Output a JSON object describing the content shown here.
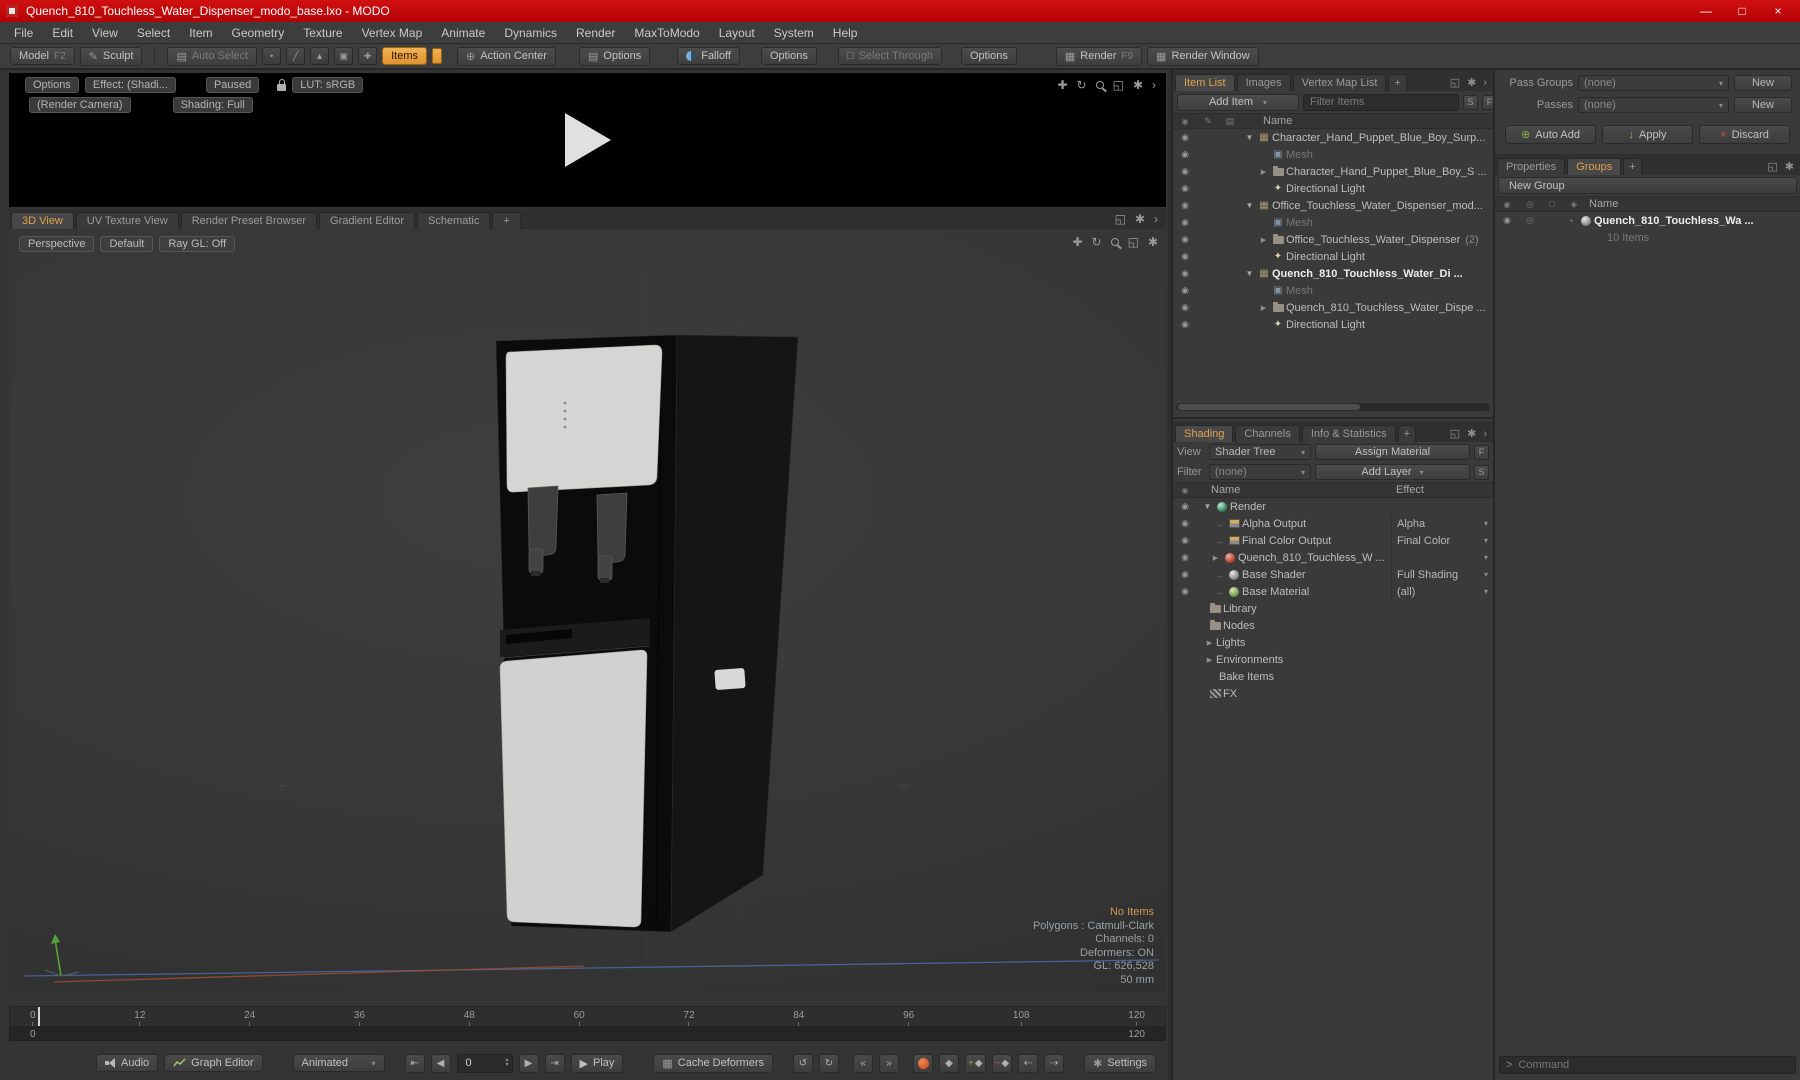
{
  "window": {
    "title": "Quench_810_Touchless_Water_Dispenser_modo_base.lxo - MODO"
  },
  "colors": {
    "titlebar_red": "#c00808",
    "accent_orange": "#e9a23f",
    "record_red": "#cc4a22",
    "no_items_orange": "#d09a50"
  },
  "icons": {
    "gear": "✱",
    "move": "✚",
    "rotate_cw": "↻",
    "rotate_ccw": "↺",
    "corner": "◱",
    "chevron": "›",
    "dropdown": "▾",
    "tri_down": "▼",
    "tri_right": "▶",
    "branch": "→",
    "spin_up": "▴",
    "spin_down": "▾",
    "play": "▶",
    "r_play": "▶",
    "rev": "◀",
    "to_start": "⇤",
    "to_end": "⇥",
    "step_back": "«",
    "step_fwd": "»",
    "key": "◆",
    "key_add": "+",
    "key_del": "−",
    "key_prev": "⇠",
    "key_next": "⇢",
    "check": "✓",
    "cross": "×",
    "down_arrow": "↓",
    "plus": "+",
    "eye": "◉",
    "min": "—",
    "max": "□",
    "close": "×",
    "pencil": "✎",
    "grid": "▤",
    "cube": "▦",
    "mesh": "▣",
    "light": "✦",
    "action": "⊕",
    "dot": "•",
    "slash": "╱",
    "tri": "▲",
    "circle": "◎",
    "diamond": "◈",
    "box": "□"
  },
  "menu": [
    "File",
    "Edit",
    "View",
    "Select",
    "Item",
    "Geometry",
    "Texture",
    "Vertex Map",
    "Animate",
    "Dynamics",
    "Render",
    "MaxToModo",
    "Layout",
    "System",
    "Help"
  ],
  "toolbar": {
    "model": "Model",
    "model_key": "F2",
    "sculpt": "Sculpt",
    "auto_select": "Auto Select",
    "items": "Items",
    "action_center": "Action Center",
    "options_a": "Options",
    "falloff": "Falloff",
    "options_b": "Options",
    "select_through": "Select Through",
    "options_c": "Options",
    "render": "Render",
    "render_key": "F9",
    "render_window": "Render Window"
  },
  "preview": {
    "options": "Options",
    "effect": "Effect: (Shadi...",
    "paused": "Paused",
    "lut": "LUT: sRGB",
    "render_camera": "(Render Camera)",
    "shading": "Shading: Full"
  },
  "viewport": {
    "tabs": [
      "3D View",
      "UV Texture View",
      "Render Preset Browser",
      "Gradient Editor",
      "Schematic"
    ],
    "add_tab": "+",
    "perspective": "Perspective",
    "default": "Default",
    "raygl": "Ray GL: Off",
    "no_items": "No Items",
    "stats": [
      "Polygons : Catmull-Clark",
      "Channels: 0",
      "Deformers: ON",
      "GL: 626,528",
      "50 mm"
    ]
  },
  "timeline": {
    "ticks": [
      "0",
      "12",
      "24",
      "36",
      "48",
      "60",
      "72",
      "84",
      "96",
      "108",
      "120"
    ],
    "range_start": "0",
    "range_end": "120"
  },
  "transport": {
    "audio": "Audio",
    "graph_editor": "Graph Editor",
    "mode": "Animated",
    "frame": "0",
    "play": "Play",
    "cache_deformers": "Cache Deformers",
    "settings": "Settings"
  },
  "item_list": {
    "tabs": [
      "Item List",
      "Images",
      "Vertex Map List"
    ],
    "add_tab": "+",
    "add_item": "Add Item",
    "filter_placeholder": "Filter Items",
    "btn_s": "S",
    "btn_f": "F",
    "name_header": "Name",
    "rows": [
      {
        "label": "Character_Hand_Puppet_Blue_Boy_Surp..."
      },
      {
        "label": "Mesh"
      },
      {
        "label": "Character_Hand_Puppet_Blue_Boy_S ..."
      },
      {
        "label": "Directional Light"
      },
      {
        "label": "Office_Touchless_Water_Dispenser_mod..."
      },
      {
        "label": "Mesh"
      },
      {
        "label": "Office_Touchless_Water_Dispenser",
        "suffix": "(2)"
      },
      {
        "label": "Directional Light"
      },
      {
        "label": "Quench_810_Touchless_Water_Di ..."
      },
      {
        "label": "Mesh"
      },
      {
        "label": "Quench_810_Touchless_Water_Dispe ..."
      },
      {
        "label": "Directional Light"
      }
    ]
  },
  "shading": {
    "tabs": [
      "Shading",
      "Channels",
      "Info & Statistics"
    ],
    "add_tab": "+",
    "view_label": "View",
    "view_value": "Shader Tree",
    "assign_material": "Assign Material",
    "btn_f": "F",
    "filter_label": "Filter",
    "filter_value": "(none)",
    "add_layer": "Add Layer",
    "btn_s": "S",
    "name_header": "Name",
    "effect_header": "Effect",
    "rows": [
      {
        "label": "Render",
        "effect": ""
      },
      {
        "label": "Alpha Output",
        "effect": "Alpha"
      },
      {
        "label": "Final Color Output",
        "effect": "Final Color"
      },
      {
        "label": "Quench_810_Touchless_W ...",
        "effect": ""
      },
      {
        "label": "Base Shader",
        "effect": "Full Shading"
      },
      {
        "label": "Base Material",
        "effect": "(all)"
      },
      {
        "label": "Library"
      },
      {
        "label": "Nodes"
      },
      {
        "label": "Lights"
      },
      {
        "label": "Environments"
      },
      {
        "label": "Bake Items"
      },
      {
        "label": "FX"
      }
    ]
  },
  "passes": {
    "pass_groups_label": "Pass Groups",
    "pass_groups_value": "(none)",
    "new_a": "New",
    "passes_label": "Passes",
    "passes_value": "(none)",
    "new_b": "New",
    "auto_add": "Auto Add",
    "apply": "Apply",
    "discard": "Discard"
  },
  "groups": {
    "tabs": [
      "Properties",
      "Groups"
    ],
    "add_tab": "+",
    "new_group": "New Group",
    "name_header": "Name",
    "item_label": "Quench_810_Touchless_Wa ...",
    "item_count": "10 Items"
  },
  "command": {
    "prompt": ">",
    "placeholder": "Command"
  }
}
